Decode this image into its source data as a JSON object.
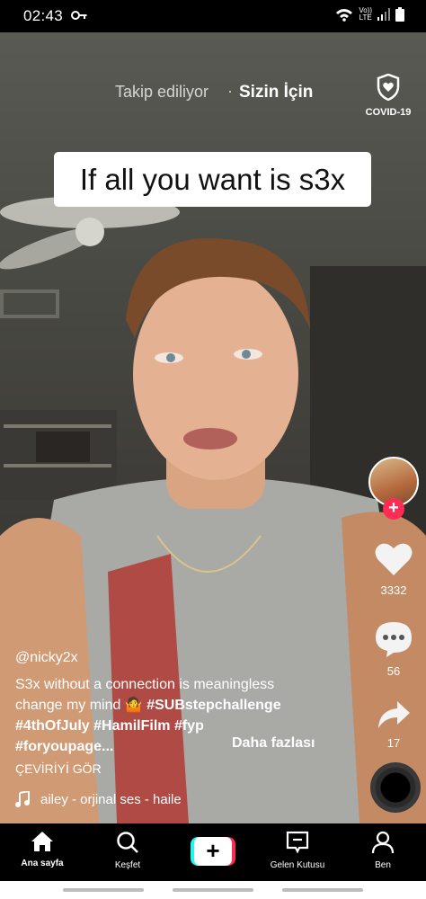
{
  "status_bar": {
    "time": "02:43",
    "volte_line1": "Vo))",
    "volte_line2": "LTE"
  },
  "top_tabs": {
    "following": "Takip ediliyor",
    "for_you": "Sizin İçin",
    "covid_label": "COVID-19"
  },
  "video": {
    "caption_overlay": "If all you want is s3x"
  },
  "actions": {
    "likes": "3332",
    "comments": "56",
    "shares": "17"
  },
  "post": {
    "username": "@nicky2x",
    "description_line1": "S3x without a connection is meaningless",
    "description_line2": "change my mind",
    "emoji": "🤷",
    "hashtag1": "#SUBstepchallenge",
    "hashtag2": "#4thOfJuly",
    "hashtag3": "#HamilFilm",
    "hashtag4": "#fyp",
    "hashtag5": "#foryoupage...",
    "more": "Daha fazlası",
    "translate": "ÇEVİRİYİ GÖR",
    "music": "ailey - orjinal ses - haile"
  },
  "bottom_nav": {
    "home": "Ana sayfa",
    "discover": "Keşfet",
    "create": "+",
    "inbox": "Gelen Kutusu",
    "me": "Ben"
  },
  "colors": {
    "accent_red": "#fe2c55",
    "accent_cyan": "#25f4ee"
  }
}
